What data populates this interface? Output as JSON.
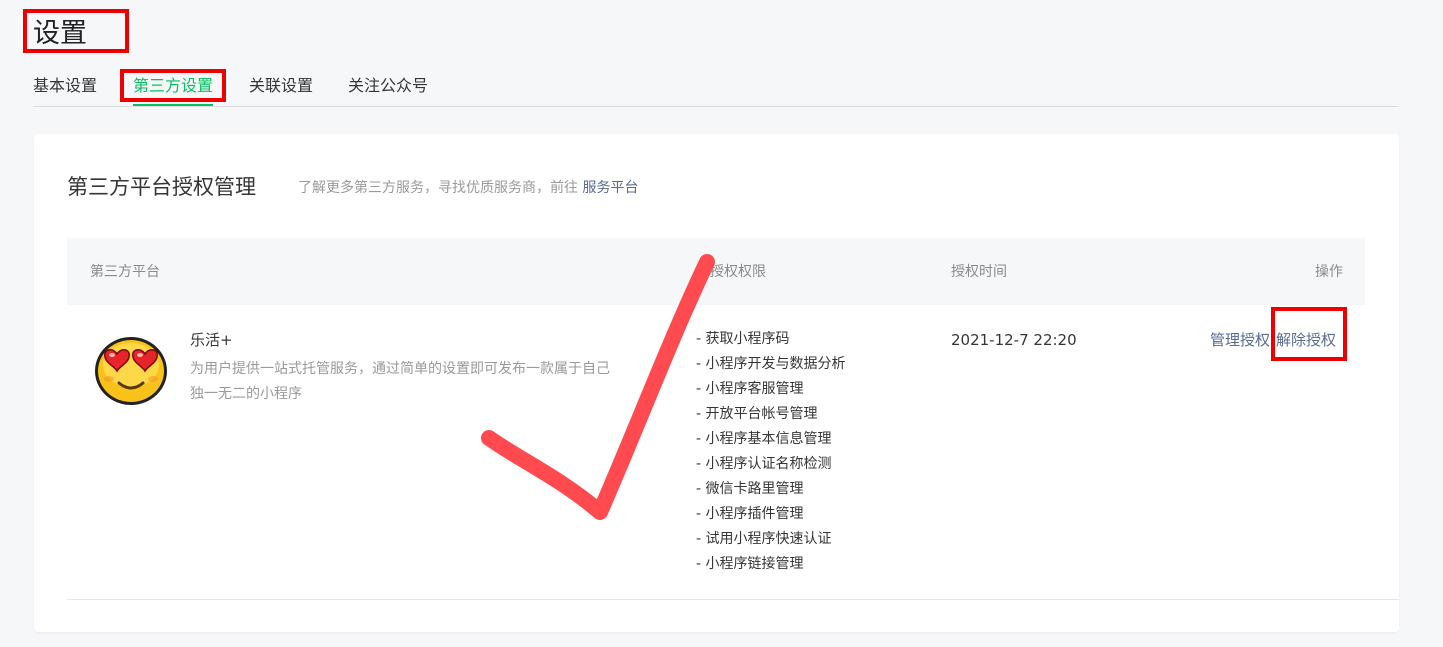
{
  "page": {
    "title": "设置"
  },
  "tabs": [
    {
      "label": "基本设置",
      "active": false
    },
    {
      "label": "第三方设置",
      "active": true
    },
    {
      "label": "关联设置",
      "active": false
    },
    {
      "label": "关注公众号",
      "active": false
    }
  ],
  "section": {
    "title": "第三方平台授权管理",
    "desc_prefix": "了解更多第三方服务，寻找优质服务商，前往",
    "desc_link": "服务平台"
  },
  "table": {
    "headers": [
      "第三方平台",
      "已授权权限",
      "授权时间",
      "操作"
    ],
    "rows": [
      {
        "avatar_icon": "heart-eyes-emoji-icon",
        "name": "乐活+",
        "desc_line1": "为用户提供一站式托管服务，通过简单的设置即可发布一款属于自己",
        "desc_line2": "独一无二的小程序",
        "permissions": [
          "- 获取小程序码",
          "- 小程序开发与数据分析",
          "- 小程序客服管理",
          "- 开放平台帐号管理",
          "- 小程序基本信息管理",
          "- 小程序认证名称检测",
          "- 微信卡路里管理",
          "- 小程序插件管理",
          "- 试用小程序快速认证",
          "- 小程序链接管理"
        ],
        "time": "2021-12-7 22:20",
        "action_manage": "管理授权",
        "action_revoke": "解除授权"
      }
    ]
  },
  "colors": {
    "accent": "#07c160",
    "link": "#576b95",
    "highlight_box": "#ee0000",
    "checkmark": "#ff4a4f"
  }
}
